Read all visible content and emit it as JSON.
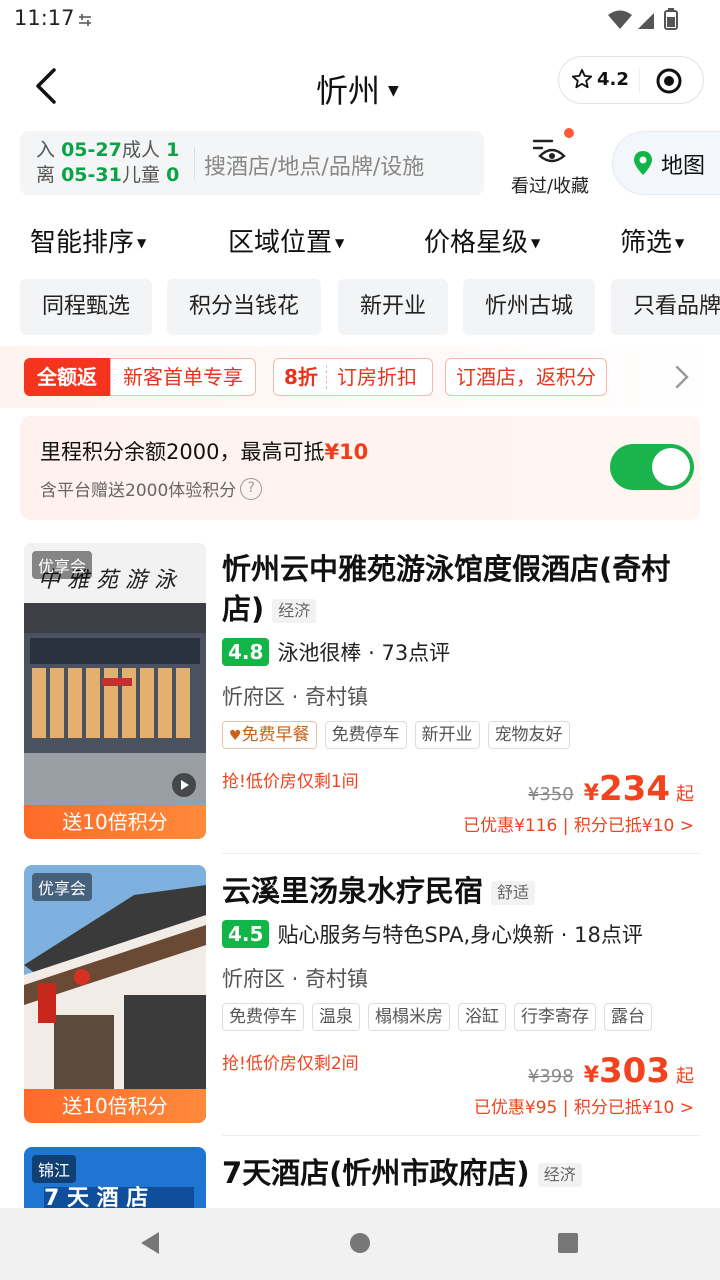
{
  "status": {
    "time": "11:17"
  },
  "header": {
    "city": "忻州",
    "rating": "4.2"
  },
  "search": {
    "checkin_label": "入",
    "checkin_date": "05-27",
    "checkout_label": "离",
    "checkout_date": "05-31",
    "adult_label": "成人",
    "adult_count": "1",
    "child_label": "儿童",
    "child_count": "0",
    "placeholder": "搜酒店/地点/品牌/设施",
    "history_label": "看过/收藏",
    "map_label": "地图"
  },
  "sort": [
    "智能排序",
    "区域位置",
    "价格星级",
    "筛选"
  ],
  "quick_tags": [
    "同程甄选",
    "积分当钱花",
    "新开业",
    "忻州古城",
    "只看品牌"
  ],
  "promo": {
    "full_return": "全额返",
    "new_customer": "新客首单专享",
    "discount_num": "8折",
    "discount_text": "订房折扣",
    "points_text": "订酒店，返积分"
  },
  "points_card": {
    "text_prefix": "里程积分余额2000，最高可抵",
    "text_amount": "¥10",
    "subtext": "含平台赠送2000体验积分",
    "toggle_on": true
  },
  "hotels": [
    {
      "badge": "优享会",
      "bonus": "送10倍积分",
      "name": "忻州云中雅苑游泳馆度假酒店(奇村店)",
      "grade": "经济",
      "score": "4.8",
      "review": "泳池很棒 · 73点评",
      "location": "忻府区 · 奇村镇",
      "tags": [
        "免费早餐",
        "免费停车",
        "新开业",
        "宠物友好"
      ],
      "urgent": "抢!低价房仅剩1间",
      "old_price": "¥350",
      "yen": "¥",
      "price": "234",
      "qi": "起",
      "discount": "已优惠¥116 | 积分已抵¥10 >"
    },
    {
      "badge": "优享会",
      "bonus": "送10倍积分",
      "name": "云溪里汤泉水疗民宿",
      "grade": "舒适",
      "score": "4.5",
      "review": "贴心服务与特色SPA,身心焕新 · 18点评",
      "location": "忻府区 · 奇村镇",
      "tags": [
        "免费停车",
        "温泉",
        "榻榻米房",
        "浴缸",
        "行李寄存",
        "露台"
      ],
      "urgent": "抢!低价房仅剩2间",
      "old_price": "¥398",
      "yen": "¥",
      "price": "303",
      "qi": "起",
      "discount": "已优惠¥95 | 积分已抵¥10 >"
    },
    {
      "badge": "锦江",
      "name": "7天酒店(忻州市政府店)",
      "grade": "经济"
    }
  ],
  "colors": {
    "accent_green": "#12b548",
    "price_red": "#f2421e"
  }
}
